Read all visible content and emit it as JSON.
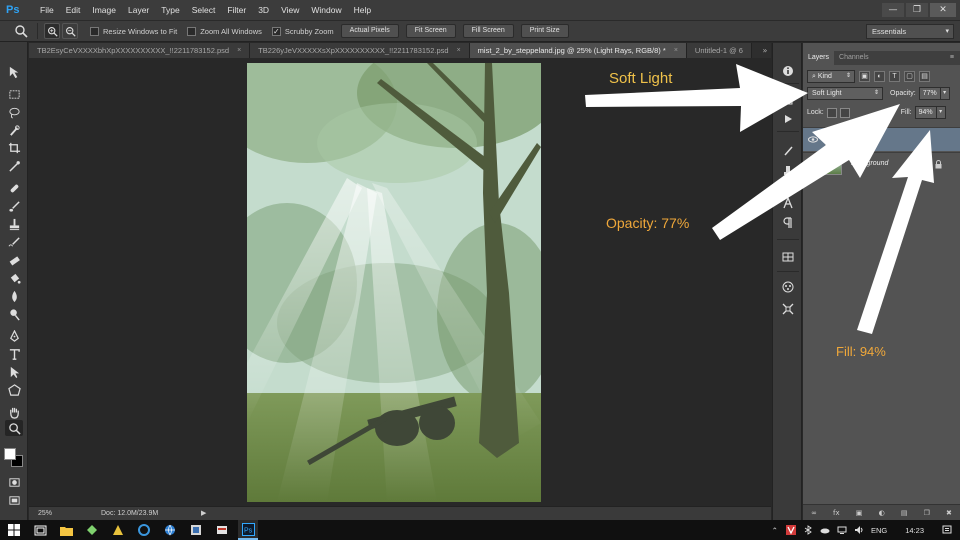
{
  "app": {
    "logo": "Ps"
  },
  "menu": [
    "File",
    "Edit",
    "Image",
    "Layer",
    "Type",
    "Select",
    "Filter",
    "3D",
    "View",
    "Window",
    "Help"
  ],
  "window_controls": {
    "minimize": "—",
    "restore": "❐",
    "close": "✕"
  },
  "options": {
    "resize_windows": "Resize Windows to Fit",
    "zoom_all": "Zoom All Windows",
    "scrubby_zoom": "Scrubby Zoom",
    "scrubby_checked": "✓",
    "actual_pixels": "Actual Pixels",
    "fit_screen": "Fit Screen",
    "fill_screen": "Fill Screen",
    "print_size": "Print Size",
    "workspace": "Essentials"
  },
  "tabs": [
    {
      "label": "TB2EsyCeVXXXXbhXpXXXXXXXXXX_!!2211783152.psd",
      "close": "×"
    },
    {
      "label": "TB226yJeVXXXXXsXpXXXXXXXXXX_!!2211783152.psd",
      "close": "×"
    },
    {
      "label": "mist_2_by_steppeland.jpg @ 25% (Light Rays, RGB/8) *",
      "close": "×"
    },
    {
      "label": "Untitled-1 @ 6",
      "close": ""
    }
  ],
  "tabs_more": "»",
  "status": {
    "zoom": "25%",
    "doc": "Doc: 12.0M/23.9M",
    "arrow": "▶"
  },
  "layers_panel": {
    "tab_layers": "Layers",
    "tab_channels": "Channels",
    "menu": "≡",
    "kind": "Kind",
    "blend_mode": "Soft Light",
    "opacity_label": "Opacity:",
    "opacity_value": "77%",
    "lock_label": "Lock:",
    "fill_label": "Fill:",
    "fill_value": "94%",
    "layers": [
      {
        "name": "Light Rays",
        "visible_name": "ays"
      },
      {
        "name": "Background"
      }
    ],
    "bottom_icons": [
      "∞",
      "fx",
      "▣",
      "◐",
      "▤",
      "❐",
      "✖"
    ]
  },
  "annotations": {
    "soft_light": "Soft Light",
    "opacity": "Opacity: 77%",
    "fill": "Fill: 94%"
  },
  "taskbar": {
    "tray_up": "⌃",
    "lang": "ENG",
    "time": "14:23"
  }
}
